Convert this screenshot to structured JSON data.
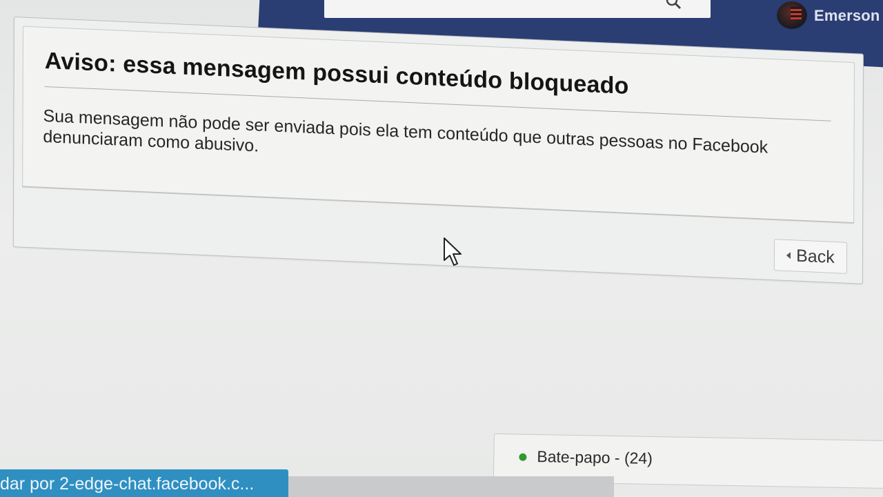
{
  "header": {
    "username": "Emerson",
    "brand_color": "#2a3e74"
  },
  "dialog": {
    "title": "Aviso: essa mensagem possui conteúdo bloqueado",
    "message": "Sua mensagem não pode ser enviada pois ela tem conteúdo que outras pessoas no Facebook denunciaram como abusivo.",
    "back_label": "Back"
  },
  "chat": {
    "label": "Bate-papo - (24)",
    "status_color": "#2e9a2e"
  },
  "status_bar": {
    "text": "dar por 2-edge-chat.facebook.c..."
  },
  "icons": {
    "search": "search-icon",
    "cursor": "cursor-icon",
    "back": "back-caret-icon",
    "online": "chat-dot-icon"
  }
}
